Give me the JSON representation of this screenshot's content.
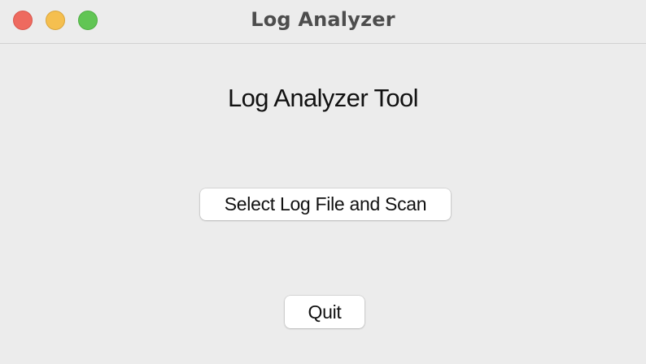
{
  "window": {
    "title": "Log Analyzer",
    "traffic_lights": {
      "close_color": "#ee6a5f",
      "minimize_color": "#f5bf4f",
      "zoom_color": "#61c554"
    }
  },
  "main": {
    "heading": "Log Analyzer Tool",
    "scan_button_label": "Select Log File and Scan",
    "quit_button_label": "Quit"
  }
}
